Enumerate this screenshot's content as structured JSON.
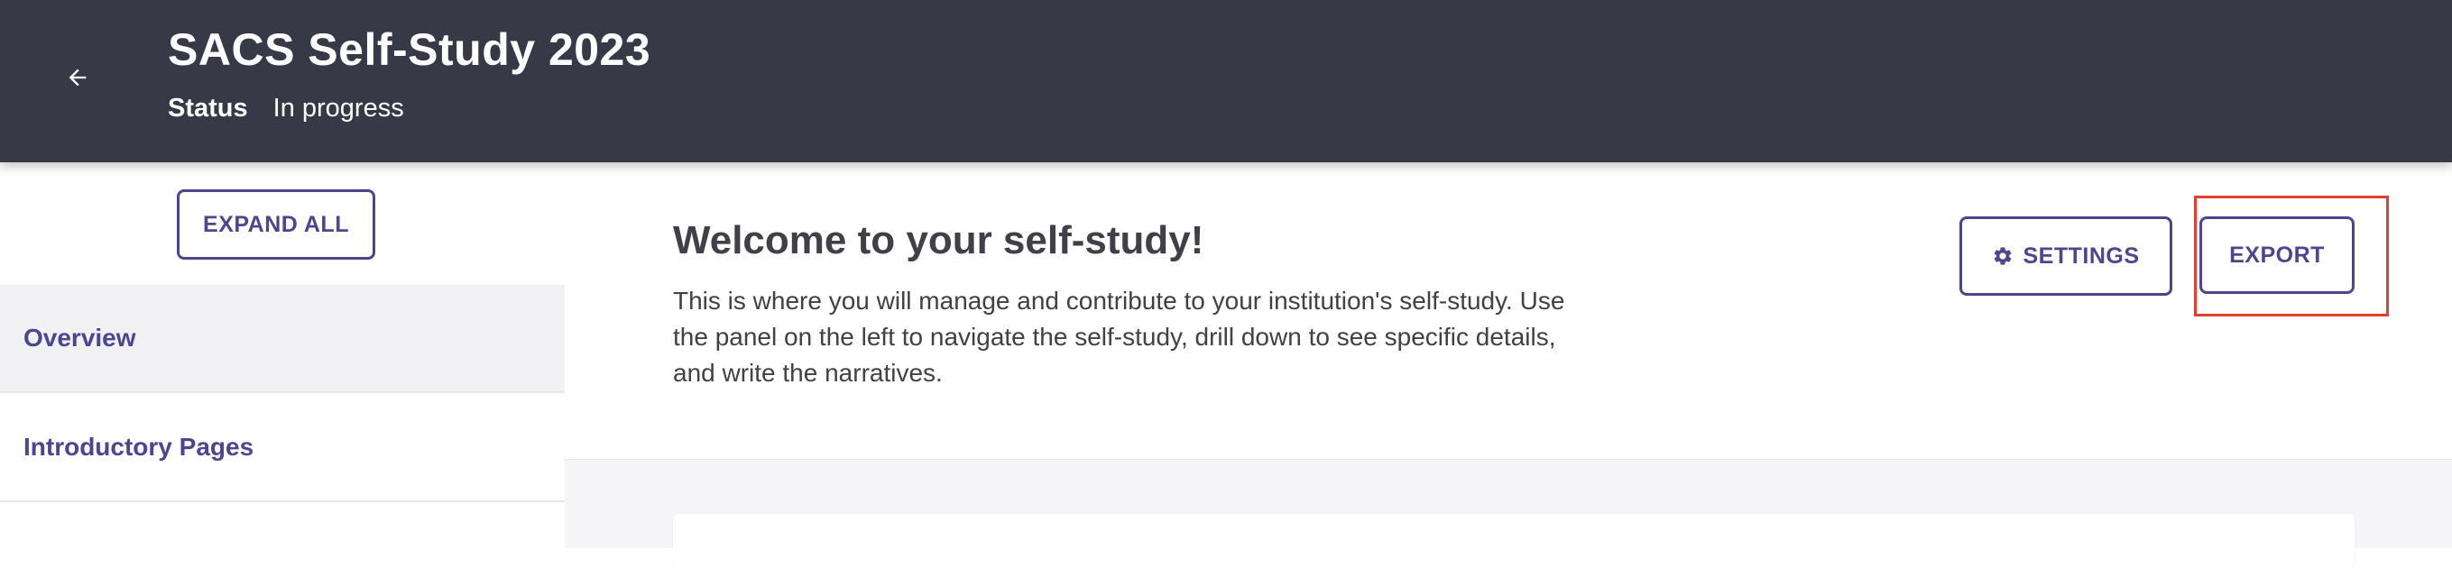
{
  "header": {
    "title": "SACS Self-Study 2023",
    "status_label": "Status",
    "status_value": "In progress",
    "back_icon": "arrow-left-icon"
  },
  "sidebar": {
    "expand_all_label": "EXPAND ALL",
    "items": [
      {
        "label": "Overview",
        "selected": true
      },
      {
        "label": "Introductory Pages",
        "selected": false
      }
    ]
  },
  "main": {
    "heading": "Welcome to your self-study!",
    "description": "This is where you will manage and contribute to your institution's self-study. Use the panel on the left to navigate the self-study, drill down to see specific details, and write the narratives.",
    "settings_label": "SETTINGS",
    "settings_icon": "gear-icon",
    "export_label": "EXPORT"
  },
  "colors": {
    "header_bg": "#373a46",
    "accent": "#4a4690",
    "selected_item_bg": "#f1f1f4",
    "highlight": "#e0402e"
  }
}
